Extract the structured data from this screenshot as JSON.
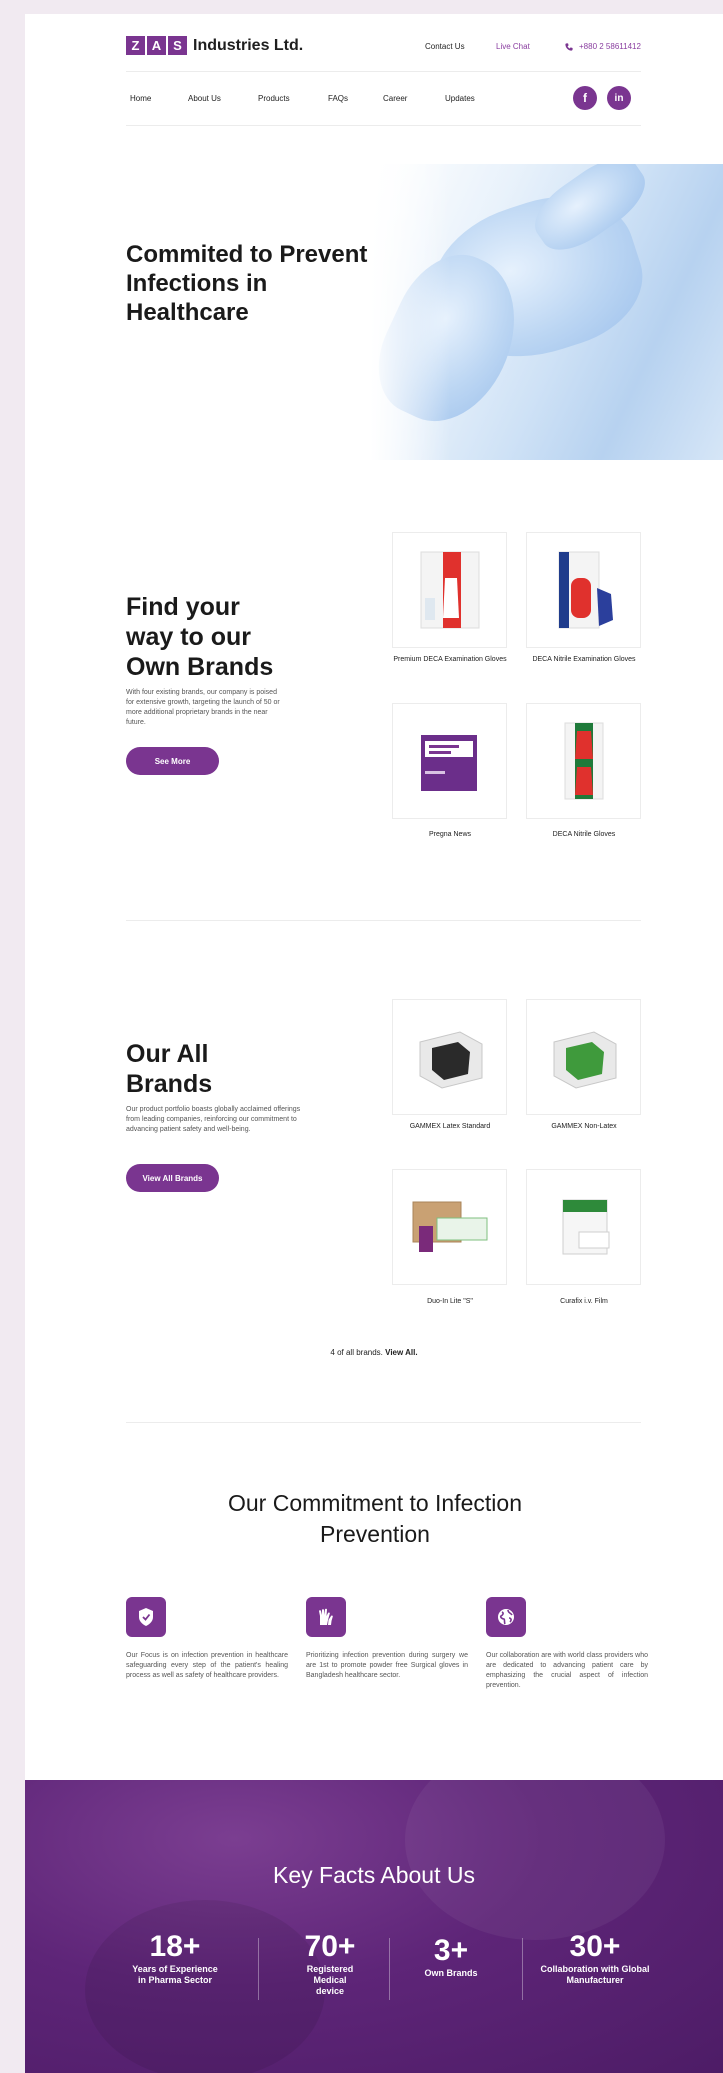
{
  "header": {
    "logo_letters": [
      "Z",
      "A",
      "S"
    ],
    "logo_text": "Industries Ltd.",
    "contact_label": "Contact Us",
    "live_chat_label": "Live Chat",
    "phone": "+880 2 58611412"
  },
  "nav": {
    "items": [
      "Home",
      "About Us",
      "Products",
      "FAQs",
      "Career",
      "Updates"
    ],
    "social": [
      "f",
      "in"
    ]
  },
  "hero": {
    "title": "Commited to Prevent Infections in Healthcare"
  },
  "own_brands": {
    "title": "Find your way to our Own Brands",
    "description": "With four existing brands, our company is poised for extensive growth, targeting the launch of 50 or more additional proprietary brands in the near future.",
    "button": "See More",
    "products": [
      {
        "name": "Premium DECA Examination Gloves"
      },
      {
        "name": "DECA Nitrile Examination Gloves"
      },
      {
        "name": "Pregna News"
      },
      {
        "name": "DECA Nitrile Gloves"
      }
    ]
  },
  "all_brands": {
    "title": "Our All Brands",
    "description": "Our product portfolio boasts globally acclaimed offerings from leading companies, reinforcing our commitment to advancing patient safety and well-being.",
    "button": "View All Brands",
    "products": [
      {
        "name": "GAMMEX Latex Standard"
      },
      {
        "name": "GAMMEX Non-Latex"
      },
      {
        "name": "Duo-In Lite \"S\""
      },
      {
        "name": "Curafix i.v. Film"
      }
    ],
    "count_text": "4 of all brands.",
    "view_all": "View All."
  },
  "commitment": {
    "title": "Our Commitment to Infection Prevention",
    "items": [
      {
        "icon": "shield-icon",
        "text": "Our Focus is on infection prevention in healthcare safeguarding every step of the patient's healing process as well as safety of healthcare providers."
      },
      {
        "icon": "gloves-icon",
        "text": "Prioritizing infection prevention during surgery we are 1st to promote powder free Surgical gloves in Bangladesh healthcare sector."
      },
      {
        "icon": "globe-icon",
        "text": "Our collaboration are with world class providers who are dedicated to advancing patient care by emphasizing the crucial aspect of infection prevention."
      }
    ]
  },
  "facts": {
    "title": "Key Facts About Us",
    "stats": [
      {
        "number": "18+",
        "label": "Years of Experience in Pharma Sector"
      },
      {
        "number": "70+",
        "label": "Registered Medical device"
      },
      {
        "number": "3+",
        "label": "Own Brands"
      },
      {
        "number": "30+",
        "label": "Collaboration with Global Manufacturer"
      }
    ]
  },
  "colors": {
    "brand": "#7a3590",
    "facts_bg": "#5e2578",
    "live_chat": "#8a3ea0"
  }
}
